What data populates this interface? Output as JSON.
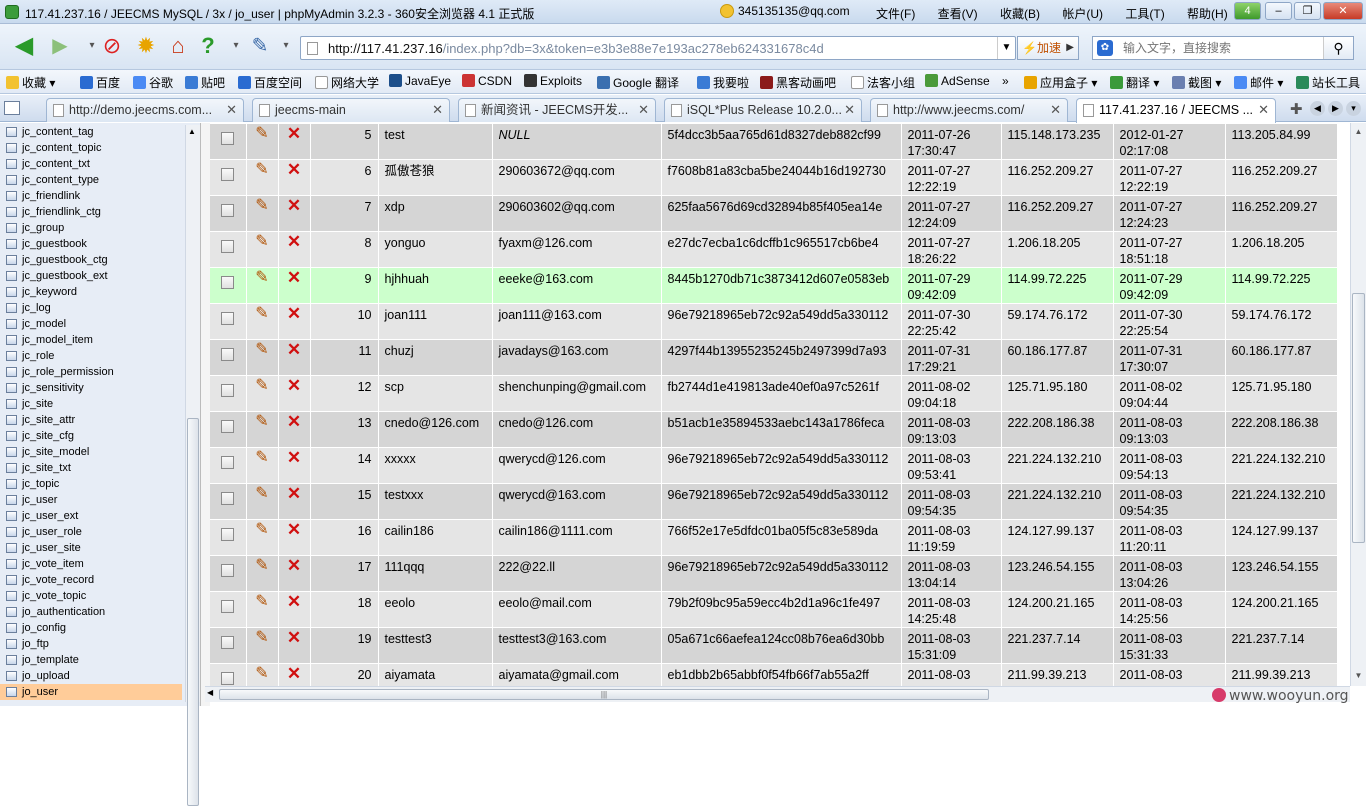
{
  "window": {
    "title": "117.41.237.16 / JEECMS MySQL / 3x / jo_user | phpMyAdmin 3.2.3 - 360安全浏览器 4.1 正式版",
    "account": "345135135@qq.com",
    "menu": [
      "文件(F)",
      "查看(V)",
      "收藏(B)",
      "帐户(U)",
      "工具(T)",
      "帮助(H)"
    ],
    "notify_count": "4"
  },
  "navbar": {
    "url_host": "http://117.41.237.16",
    "url_rest": "/index.php?db=3x&token=e3b3e88e7e193ac278eb624331678c4d",
    "speed_label": "⚡加速",
    "search_placeholder": "输入文字，直接搜索"
  },
  "favorites": [
    "收藏",
    "百度",
    "谷歌",
    "贴吧",
    "百度空间",
    "网络大学",
    "JavaEye",
    "CSDN",
    "Exploits",
    "Google 翻译",
    "我要啦",
    "黑客动画吧",
    "法客小组",
    "AdSense",
    "»",
    "应用盒子",
    "翻译",
    "截图",
    "邮件",
    "站长工具"
  ],
  "tabs": [
    {
      "label": "http://demo.jeecms.com..."
    },
    {
      "label": "jeecms-main"
    },
    {
      "label": "新闻资讯 - JEECMS开发..."
    },
    {
      "label": "iSQL*Plus Release 10.2.0..."
    },
    {
      "label": "http://www.jeecms.com/"
    },
    {
      "label": "117.41.237.16 / JEECMS ..."
    }
  ],
  "sidebar": {
    "tables": [
      "jc_content_tag",
      "jc_content_topic",
      "jc_content_txt",
      "jc_content_type",
      "jc_friendlink",
      "jc_friendlink_ctg",
      "jc_group",
      "jc_guestbook",
      "jc_guestbook_ctg",
      "jc_guestbook_ext",
      "jc_keyword",
      "jc_log",
      "jc_model",
      "jc_model_item",
      "jc_role",
      "jc_role_permission",
      "jc_sensitivity",
      "jc_site",
      "jc_site_attr",
      "jc_site_cfg",
      "jc_site_model",
      "jc_site_txt",
      "jc_topic",
      "jc_user",
      "jc_user_ext",
      "jc_user_role",
      "jc_user_site",
      "jc_vote_item",
      "jc_vote_record",
      "jc_vote_topic",
      "jo_authentication",
      "jo_config",
      "jo_ftp",
      "jo_template",
      "jo_upload",
      "jo_user"
    ],
    "selected_index": 35
  },
  "grid": {
    "top_partial": {
      "reg_time": "15:42:10",
      "login_time": "18:12:51"
    },
    "rows": [
      {
        "id": "5",
        "username": "test",
        "email": "NULL",
        "password": "5f4dcc3b5aa765d61d8327deb882cf99",
        "reg_date": "2011-07-26",
        "reg_time": "17:30:47",
        "reg_ip": "115.148.173.235",
        "login_date": "2012-01-27",
        "login_time": "02:17:08",
        "login_ip": "113.205.84.99"
      },
      {
        "id": "6",
        "username": "孤傲苍狼",
        "email": "290603672@qq.com",
        "password": "f7608b81a83cba5be24044b16d192730",
        "reg_date": "2011-07-27",
        "reg_time": "12:22:19",
        "reg_ip": "116.252.209.27",
        "login_date": "2011-07-27",
        "login_time": "12:22:19",
        "login_ip": "116.252.209.27"
      },
      {
        "id": "7",
        "username": "xdp",
        "email": "290603602@qq.com",
        "password": "625faa5676d69cd32894b85f405ea14e",
        "reg_date": "2011-07-27",
        "reg_time": "12:24:09",
        "reg_ip": "116.252.209.27",
        "login_date": "2011-07-27",
        "login_time": "12:24:23",
        "login_ip": "116.252.209.27"
      },
      {
        "id": "8",
        "username": "yonguo",
        "email": "fyaxm@126.com",
        "password": "e27dc7ecba1c6dcffb1c965517cb6be4",
        "reg_date": "2011-07-27",
        "reg_time": "18:26:22",
        "reg_ip": "1.206.18.205",
        "login_date": "2011-07-27",
        "login_time": "18:51:18",
        "login_ip": "1.206.18.205"
      },
      {
        "id": "9",
        "username": "hjhhuah",
        "email": "eeeke@163.com",
        "password": "8445b1270db71c3873412d607e0583eb",
        "reg_date": "2011-07-29",
        "reg_time": "09:42:09",
        "reg_ip": "114.99.72.225",
        "login_date": "2011-07-29",
        "login_time": "09:42:09",
        "login_ip": "114.99.72.225"
      },
      {
        "id": "10",
        "username": "joan111",
        "email": "joan111@163.com",
        "password": "96e79218965eb72c92a549dd5a330112",
        "reg_date": "2011-07-30",
        "reg_time": "22:25:42",
        "reg_ip": "59.174.76.172",
        "login_date": "2011-07-30",
        "login_time": "22:25:54",
        "login_ip": "59.174.76.172"
      },
      {
        "id": "11",
        "username": "chuzj",
        "email": "javadays@163.com",
        "password": "4297f44b13955235245b2497399d7a93",
        "reg_date": "2011-07-31",
        "reg_time": "17:29:21",
        "reg_ip": "60.186.177.87",
        "login_date": "2011-07-31",
        "login_time": "17:30:07",
        "login_ip": "60.186.177.87"
      },
      {
        "id": "12",
        "username": "scp",
        "email": "shenchunping@gmail.com",
        "password": "fb2744d1e419813ade40ef0a97c5261f",
        "reg_date": "2011-08-02",
        "reg_time": "09:04:18",
        "reg_ip": "125.71.95.180",
        "login_date": "2011-08-02",
        "login_time": "09:04:44",
        "login_ip": "125.71.95.180"
      },
      {
        "id": "13",
        "username": "cnedo@126.com",
        "email": "cnedo@126.com",
        "password": "b51acb1e35894533aebc143a1786feca",
        "reg_date": "2011-08-03",
        "reg_time": "09:13:03",
        "reg_ip": "222.208.186.38",
        "login_date": "2011-08-03",
        "login_time": "09:13:03",
        "login_ip": "222.208.186.38"
      },
      {
        "id": "14",
        "username": "xxxxx",
        "email": "qwerycd@126.com",
        "password": "96e79218965eb72c92a549dd5a330112",
        "reg_date": "2011-08-03",
        "reg_time": "09:53:41",
        "reg_ip": "221.224.132.210",
        "login_date": "2011-08-03",
        "login_time": "09:54:13",
        "login_ip": "221.224.132.210"
      },
      {
        "id": "15",
        "username": "testxxx",
        "email": "qwerycd@163.com",
        "password": "96e79218965eb72c92a549dd5a330112",
        "reg_date": "2011-08-03",
        "reg_time": "09:54:35",
        "reg_ip": "221.224.132.210",
        "login_date": "2011-08-03",
        "login_time": "09:54:35",
        "login_ip": "221.224.132.210"
      },
      {
        "id": "16",
        "username": "cailin186",
        "email": "cailin186@1111.com",
        "password": "766f52e17e5dfdc01ba05f5c83e589da",
        "reg_date": "2011-08-03",
        "reg_time": "11:19:59",
        "reg_ip": "124.127.99.137",
        "login_date": "2011-08-03",
        "login_time": "11:20:11",
        "login_ip": "124.127.99.137"
      },
      {
        "id": "17",
        "username": "111qqq",
        "email": "222@22.ll",
        "password": "96e79218965eb72c92a549dd5a330112",
        "reg_date": "2011-08-03",
        "reg_time": "13:04:14",
        "reg_ip": "123.246.54.155",
        "login_date": "2011-08-03",
        "login_time": "13:04:26",
        "login_ip": "123.246.54.155"
      },
      {
        "id": "18",
        "username": "eeolo",
        "email": "eeolo@mail.com",
        "password": "79b2f09bc95a59ecc4b2d1a96c1fe497",
        "reg_date": "2011-08-03",
        "reg_time": "14:25:48",
        "reg_ip": "124.200.21.165",
        "login_date": "2011-08-03",
        "login_time": "14:25:56",
        "login_ip": "124.200.21.165"
      },
      {
        "id": "19",
        "username": "testtest3",
        "email": "testtest3@163.com",
        "password": "05a671c66aefea124cc08b76ea6d30bb",
        "reg_date": "2011-08-03",
        "reg_time": "15:31:09",
        "reg_ip": "221.237.7.14",
        "login_date": "2011-08-03",
        "login_time": "15:31:33",
        "login_ip": "221.237.7.14"
      },
      {
        "id": "20",
        "username": "aiyamata",
        "email": "aiyamata@gmail.com",
        "password": "eb1dbb2b65abbf0f54fb66f7ab55a2ff",
        "reg_date": "2011-08-03",
        "reg_time": "",
        "reg_ip": "211.99.39.213",
        "login_date": "2011-08-03",
        "login_time": "",
        "login_ip": "211.99.39.213"
      }
    ],
    "highlight_id": "9"
  },
  "watermark": "www.wooyun.org"
}
